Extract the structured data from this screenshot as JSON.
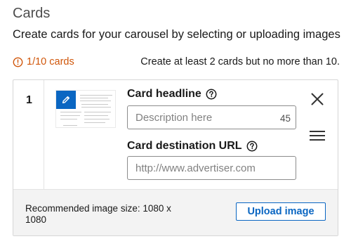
{
  "header": {
    "title": "Cards",
    "subtitle": "Create cards for your carousel by selecting or uploading images"
  },
  "status": {
    "count_text": "1/10 cards",
    "rule_text": "Create at least 2 cards but no more than 10."
  },
  "card": {
    "index": "1",
    "headline_label": "Card headline",
    "headline_placeholder": "Description here",
    "headline_remaining": "45",
    "url_label": "Card destination URL",
    "url_placeholder": "http://www.advertiser.com"
  },
  "footer": {
    "recommended_text": "Recommended image size: 1080 x 1080",
    "upload_label": "Upload image"
  },
  "icons": {
    "alert": "alert-circle-icon",
    "help": "help-circle-icon",
    "edit": "pencil-icon",
    "close": "close-icon",
    "drag": "drag-handle-icon"
  },
  "colors": {
    "accent": "#0a66c2",
    "warning": "#d0560a",
    "footer_bg": "#f3f3f3"
  }
}
